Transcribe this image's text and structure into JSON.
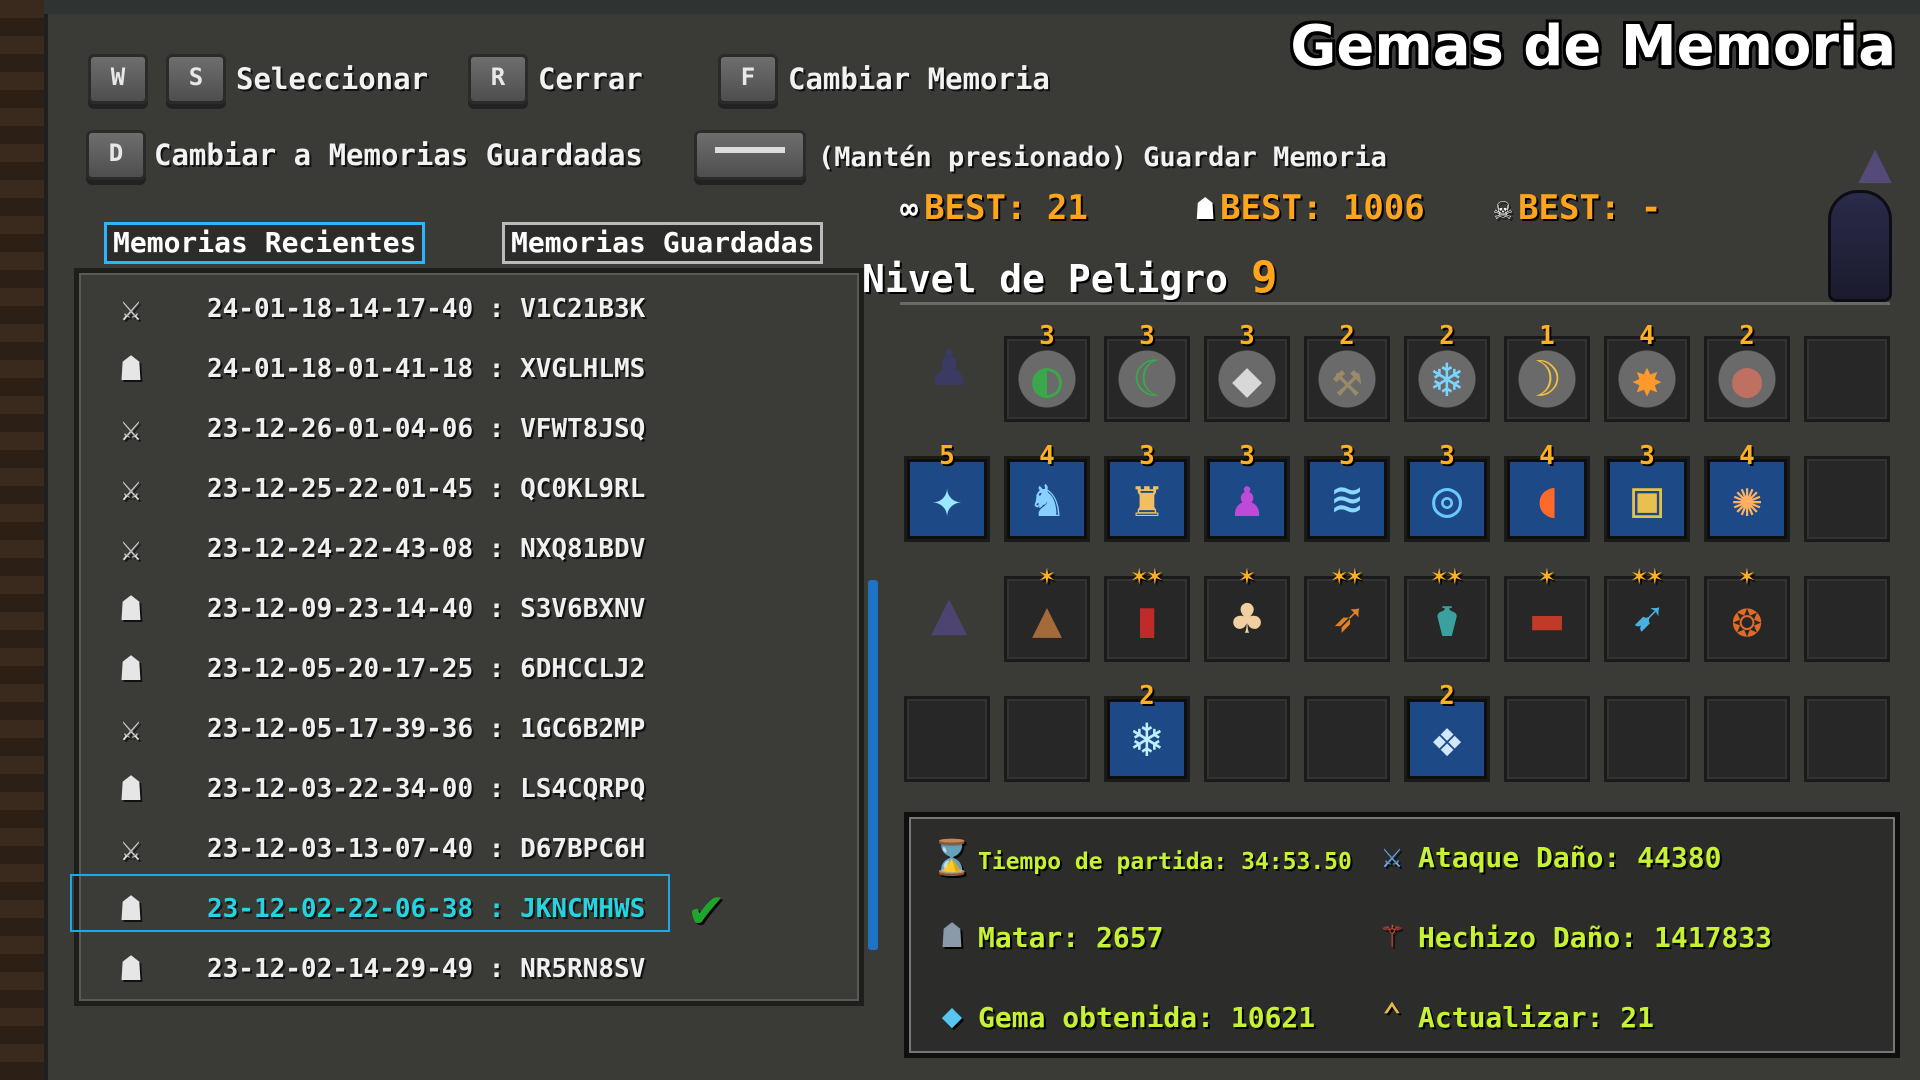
{
  "title": "Gemas de Memoria",
  "controls": {
    "w_key": "W",
    "s_key": "S",
    "select_label": "Seleccionar",
    "r_key": "R",
    "close_label": "Cerrar",
    "f_key": "F",
    "change_label": "Cambiar Memoria",
    "d_key": "D",
    "switch_label": "Cambiar a Memorias Guardadas",
    "hold_label": "(Mantén presionado) Guardar Memoria"
  },
  "best": [
    {
      "icon": "infinity-icon",
      "glyph": "∞",
      "label": "BEST: 21"
    },
    {
      "icon": "helmet-icon",
      "glyph": "☗",
      "label": "BEST: 1006"
    },
    {
      "icon": "demon-mask-icon",
      "glyph": "☠",
      "label": "BEST: -"
    }
  ],
  "tabs": {
    "recent": "Memorias Recientes",
    "saved": "Memorias Guardadas"
  },
  "memories": [
    {
      "icon": "sword-icon",
      "text": "24-01-18-14-17-40 : V1C21B3K"
    },
    {
      "icon": "tombstone-icon",
      "text": "24-01-18-01-41-18 : XVGLHLMS"
    },
    {
      "icon": "sword-icon",
      "text": "23-12-26-01-04-06 : VFWT8JSQ"
    },
    {
      "icon": "sword-icon",
      "text": "23-12-25-22-01-45 : QC0KL9RL"
    },
    {
      "icon": "sword-icon",
      "text": "23-12-24-22-43-08 : NXQ81BDV"
    },
    {
      "icon": "tombstone-icon",
      "text": "23-12-09-23-14-40 : S3V6BXNV"
    },
    {
      "icon": "tombstone-icon",
      "text": "23-12-05-20-17-25 : 6DHCCLJ2"
    },
    {
      "icon": "sword-icon",
      "text": "23-12-05-17-39-36 : 1GC6B2MP"
    },
    {
      "icon": "tombstone-icon",
      "text": "23-12-03-22-34-00 : LS4CQRPQ"
    },
    {
      "icon": "sword-icon",
      "text": "23-12-03-13-07-40 : D67BPC6H"
    },
    {
      "icon": "tombstone-icon",
      "text": "23-12-02-22-06-38 : JKNCMHWS"
    },
    {
      "icon": "tombstone-icon",
      "text": "23-12-02-14-29-49 : NR5RN8SV"
    }
  ],
  "selected_index": 10,
  "danger": {
    "label": "Nivel de Peligro",
    "level": "9"
  },
  "rows": {
    "weapons": [
      {
        "level": "3",
        "icon": "striped-orb-icon",
        "glyph": "◐"
      },
      {
        "level": "3",
        "icon": "crescent-ring-icon",
        "glyph": "☾"
      },
      {
        "level": "3",
        "icon": "diamond-blade-icon",
        "glyph": "◆"
      },
      {
        "level": "2",
        "icon": "hammer-icon",
        "glyph": "⚒"
      },
      {
        "level": "2",
        "icon": "frost-ring-icon",
        "glyph": "❄"
      },
      {
        "level": "1",
        "icon": "moon-orb-icon",
        "glyph": "☽"
      },
      {
        "level": "4",
        "icon": "burst-orb-icon",
        "glyph": "✸"
      },
      {
        "level": "2",
        "icon": "meat-orb-icon",
        "glyph": "●"
      },
      {
        "level": "",
        "icon": "empty-slot-icon",
        "glyph": ""
      }
    ],
    "magic": [
      {
        "level": "5",
        "icon": "ice-shards-icon",
        "glyph": "✦"
      },
      {
        "level": "4",
        "icon": "spirit-beast-icon",
        "glyph": "♞"
      },
      {
        "level": "3",
        "icon": "golden-dragon-icon",
        "glyph": "♜"
      },
      {
        "level": "3",
        "icon": "shadow-figure-icon",
        "glyph": "♟"
      },
      {
        "level": "3",
        "icon": "ice-wave-icon",
        "glyph": "≋"
      },
      {
        "level": "3",
        "icon": "arcane-circle-icon",
        "glyph": "◎"
      },
      {
        "level": "4",
        "icon": "fire-crescent-icon",
        "glyph": "◖"
      },
      {
        "level": "3",
        "icon": "golden-frame-icon",
        "glyph": "▣"
      },
      {
        "level": "4",
        "icon": "explosion-icon",
        "glyph": "✺"
      },
      {
        "level": "",
        "icon": "empty-slot-icon",
        "glyph": ""
      }
    ],
    "passives": [
      {
        "level": "✶",
        "icon": "witch-hat-icon",
        "glyph": "▲"
      },
      {
        "level": "✶✶",
        "icon": "red-boots-icon",
        "glyph": "▮"
      },
      {
        "level": "✶",
        "icon": "cloak-icon",
        "glyph": "♣"
      },
      {
        "level": "✶✶",
        "icon": "fire-arrow-icon",
        "glyph": "➶"
      },
      {
        "level": "✶✶",
        "icon": "potion-jar-icon",
        "glyph": "⚱"
      },
      {
        "level": "✶",
        "icon": "meat-icon",
        "glyph": "▬"
      },
      {
        "level": "✶✶",
        "icon": "arrows-icon",
        "glyph": "➹"
      },
      {
        "level": "✶",
        "icon": "shield-emblem-icon",
        "glyph": "❂"
      },
      {
        "level": "",
        "icon": "empty-slot-icon",
        "glyph": ""
      }
    ],
    "extras": [
      {
        "level": "",
        "glyph": ""
      },
      {
        "level": "",
        "glyph": ""
      },
      {
        "level": "2",
        "icon": "snowflake-icon",
        "glyph": "❄"
      },
      {
        "level": "",
        "glyph": ""
      },
      {
        "level": "",
        "glyph": ""
      },
      {
        "level": "2",
        "icon": "crystal-wings-icon",
        "glyph": "❖"
      },
      {
        "level": "",
        "glyph": ""
      },
      {
        "level": "",
        "glyph": ""
      },
      {
        "level": "",
        "glyph": ""
      },
      {
        "level": "",
        "glyph": ""
      }
    ]
  },
  "stats": {
    "time": "Tiempo de partida: 34:53.50",
    "attack": "Ataque Daño: 44380",
    "kills": "Matar: 2657",
    "spell": "Hechizo Daño: 1417833",
    "gems": "Gema obtenida: 10621",
    "upgrade": "Actualizar: 21"
  },
  "colors": {
    "accent_orange": "#ffa51c",
    "stat_green": "#c7f233",
    "selection_blue": "#29b6ff",
    "selected_text": "#27d3e0"
  }
}
